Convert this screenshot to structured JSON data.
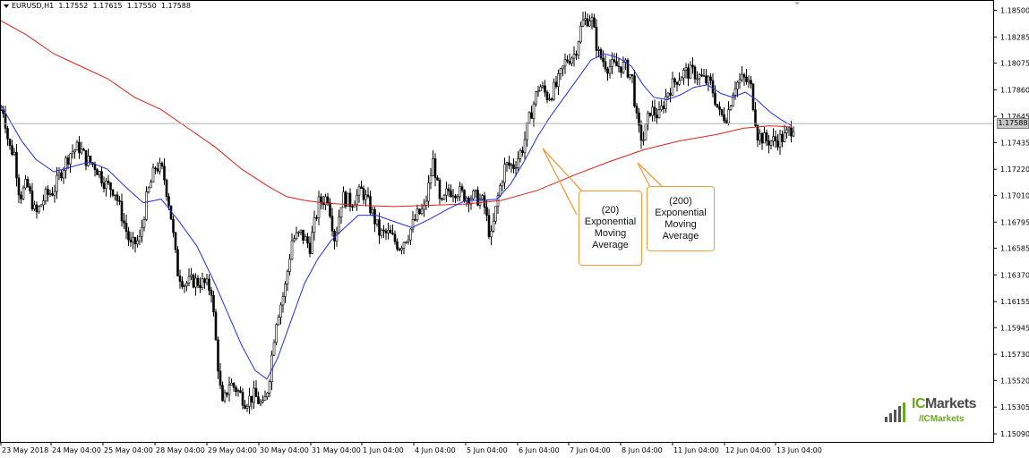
{
  "header": {
    "symbol": "EURUSD,H1",
    "open": "1.17552",
    "high": "1.17615",
    "low": "1.17550",
    "close": "1.17588"
  },
  "current_price_label": "1.17588",
  "annotations": {
    "ema20": [
      "(20)",
      "Exponential",
      "Moving",
      "Average"
    ],
    "ema200": [
      "(200)",
      "Exponential",
      "Moving",
      "Average"
    ]
  },
  "logo": {
    "brand_ic": "IC",
    "brand_rest": "Markets",
    "sub": "/ICMarkets"
  },
  "colors": {
    "ema20": "#1f2ee6",
    "ema200": "#e0201a",
    "annotation_border": "#f39a3a",
    "candles": "#000000",
    "logo_green": "#6aaa1e"
  },
  "chart_data": {
    "type": "candlestick",
    "ylim": [
      1.15,
      1.1865
    ],
    "y_ticks": [
      "1.18500",
      "1.18285",
      "1.18075",
      "1.17860",
      "1.17645",
      "1.17435",
      "1.17220",
      "1.17010",
      "1.16795",
      "1.16585",
      "1.16370",
      "1.16155",
      "1.15945",
      "1.15730",
      "1.15520",
      "1.15305",
      "1.15090"
    ],
    "x_ticks": [
      "23 May 2018",
      "24 May 04:00",
      "25 May 04:00",
      "28 May 04:00",
      "29 May 04:00",
      "30 May 04:00",
      "31 May 04:00",
      "1 Jun 04:00",
      "4 Jun 04:00",
      "5 Jun 04:00",
      "6 Jun 04:00",
      "7 Jun 04:00",
      "8 Jun 04:00",
      "11 Jun 04:00",
      "12 Jun 04:00",
      "13 Jun 04:00"
    ],
    "current_price": 1.17588,
    "price_path": [
      [
        0,
        1.177
      ],
      [
        4,
        1.177
      ],
      [
        10,
        1.174
      ],
      [
        16,
        1.1735
      ],
      [
        22,
        1.17
      ],
      [
        30,
        1.171
      ],
      [
        40,
        1.1685
      ],
      [
        50,
        1.17
      ],
      [
        60,
        1.1705
      ],
      [
        68,
        1.172
      ],
      [
        78,
        1.1735
      ],
      [
        88,
        1.174
      ],
      [
        96,
        1.173
      ],
      [
        106,
        1.1725
      ],
      [
        118,
        1.171
      ],
      [
        128,
        1.1705
      ],
      [
        138,
        1.168
      ],
      [
        146,
        1.166
      ],
      [
        156,
        1.1665
      ],
      [
        164,
        1.17
      ],
      [
        174,
        1.1725
      ],
      [
        182,
        1.172
      ],
      [
        190,
        1.169
      ],
      [
        198,
        1.164
      ],
      [
        206,
        1.163
      ],
      [
        216,
        1.1632
      ],
      [
        228,
        1.163
      ],
      [
        236,
        1.1625
      ],
      [
        242,
        1.1575
      ],
      [
        248,
        1.153
      ],
      [
        256,
        1.155
      ],
      [
        264,
        1.1545
      ],
      [
        274,
        1.1535
      ],
      [
        284,
        1.154
      ],
      [
        294,
        1.153
      ],
      [
        300,
        1.155
      ],
      [
        308,
        1.16
      ],
      [
        318,
        1.1625
      ],
      [
        326,
        1.1665
      ],
      [
        336,
        1.167
      ],
      [
        346,
        1.166
      ],
      [
        356,
        1.1695
      ],
      [
        366,
        1.17
      ],
      [
        374,
        1.1665
      ],
      [
        382,
        1.17
      ],
      [
        392,
        1.1695
      ],
      [
        404,
        1.1705
      ],
      [
        414,
        1.169
      ],
      [
        424,
        1.167
      ],
      [
        434,
        1.167
      ],
      [
        446,
        1.166
      ],
      [
        456,
        1.167
      ],
      [
        466,
        1.1685
      ],
      [
        474,
        1.169
      ],
      [
        484,
        1.173
      ],
      [
        492,
        1.169
      ],
      [
        500,
        1.1705
      ],
      [
        510,
        1.1705
      ],
      [
        520,
        1.17
      ],
      [
        530,
        1.17
      ],
      [
        540,
        1.1695
      ],
      [
        548,
        1.1665
      ],
      [
        556,
        1.17
      ],
      [
        564,
        1.1725
      ],
      [
        574,
        1.1725
      ],
      [
        584,
        1.174
      ],
      [
        592,
        1.1765
      ],
      [
        602,
        1.179
      ],
      [
        612,
        1.178
      ],
      [
        622,
        1.179
      ],
      [
        632,
        1.181
      ],
      [
        642,
        1.1815
      ],
      [
        650,
        1.184
      ],
      [
        660,
        1.1845
      ],
      [
        668,
        1.1815
      ],
      [
        678,
        1.1805
      ],
      [
        688,
        1.1805
      ],
      [
        698,
        1.1805
      ],
      [
        706,
        1.1795
      ],
      [
        712,
        1.1755
      ],
      [
        718,
        1.1745
      ],
      [
        726,
        1.177
      ],
      [
        736,
        1.1765
      ],
      [
        746,
        1.1785
      ],
      [
        756,
        1.1795
      ],
      [
        764,
        1.18
      ],
      [
        774,
        1.18
      ],
      [
        784,
        1.1795
      ],
      [
        794,
        1.179
      ],
      [
        804,
        1.1765
      ],
      [
        812,
        1.1765
      ],
      [
        820,
        1.179
      ],
      [
        830,
        1.1795
      ],
      [
        838,
        1.179
      ],
      [
        846,
        1.175
      ],
      [
        856,
        1.1745
      ],
      [
        866,
        1.1745
      ],
      [
        876,
        1.1748
      ],
      [
        884,
        1.1755
      ],
      [
        887,
        1.17588
      ]
    ],
    "ema20_path": [
      [
        0,
        1.1775
      ],
      [
        12,
        1.176
      ],
      [
        24,
        1.1745
      ],
      [
        40,
        1.173
      ],
      [
        60,
        1.172
      ],
      [
        80,
        1.1724
      ],
      [
        100,
        1.1728
      ],
      [
        120,
        1.1722
      ],
      [
        140,
        1.1708
      ],
      [
        160,
        1.1695
      ],
      [
        180,
        1.1698
      ],
      [
        200,
        1.168
      ],
      [
        220,
        1.166
      ],
      [
        240,
        1.163
      ],
      [
        255,
        1.1605
      ],
      [
        270,
        1.158
      ],
      [
        285,
        1.156
      ],
      [
        298,
        1.1553
      ],
      [
        310,
        1.157
      ],
      [
        325,
        1.16
      ],
      [
        340,
        1.163
      ],
      [
        355,
        1.165
      ],
      [
        370,
        1.1665
      ],
      [
        385,
        1.1675
      ],
      [
        400,
        1.1685
      ],
      [
        420,
        1.1685
      ],
      [
        440,
        1.168
      ],
      [
        460,
        1.1675
      ],
      [
        480,
        1.1682
      ],
      [
        500,
        1.169
      ],
      [
        520,
        1.1697
      ],
      [
        540,
        1.1697
      ],
      [
        555,
        1.1698
      ],
      [
        570,
        1.171
      ],
      [
        585,
        1.1728
      ],
      [
        600,
        1.1748
      ],
      [
        615,
        1.1765
      ],
      [
        630,
        1.178
      ],
      [
        645,
        1.1795
      ],
      [
        660,
        1.181
      ],
      [
        675,
        1.1815
      ],
      [
        690,
        1.1812
      ],
      [
        705,
        1.1805
      ],
      [
        718,
        1.179
      ],
      [
        730,
        1.178
      ],
      [
        745,
        1.1778
      ],
      [
        760,
        1.1782
      ],
      [
        775,
        1.1788
      ],
      [
        790,
        1.179
      ],
      [
        805,
        1.1783
      ],
      [
        818,
        1.178
      ],
      [
        832,
        1.1784
      ],
      [
        845,
        1.1778
      ],
      [
        860,
        1.1768
      ],
      [
        872,
        1.1762
      ],
      [
        884,
        1.1757
      ]
    ],
    "ema200_path": [
      [
        0,
        1.1842
      ],
      [
        30,
        1.183
      ],
      [
        60,
        1.1815
      ],
      [
        90,
        1.1805
      ],
      [
        120,
        1.1795
      ],
      [
        150,
        1.178
      ],
      [
        180,
        1.177
      ],
      [
        210,
        1.1755
      ],
      [
        240,
        1.174
      ],
      [
        270,
        1.1722
      ],
      [
        300,
        1.1708
      ],
      [
        320,
        1.17
      ],
      [
        340,
        1.1697
      ],
      [
        360,
        1.1695
      ],
      [
        400,
        1.1693
      ],
      [
        440,
        1.1692
      ],
      [
        480,
        1.1693
      ],
      [
        520,
        1.1694
      ],
      [
        560,
        1.1697
      ],
      [
        600,
        1.1705
      ],
      [
        640,
        1.1717
      ],
      [
        680,
        1.1728
      ],
      [
        720,
        1.1738
      ],
      [
        760,
        1.1745
      ],
      [
        800,
        1.175
      ],
      [
        830,
        1.1755
      ],
      [
        860,
        1.1757
      ],
      [
        884,
        1.1756
      ]
    ]
  }
}
